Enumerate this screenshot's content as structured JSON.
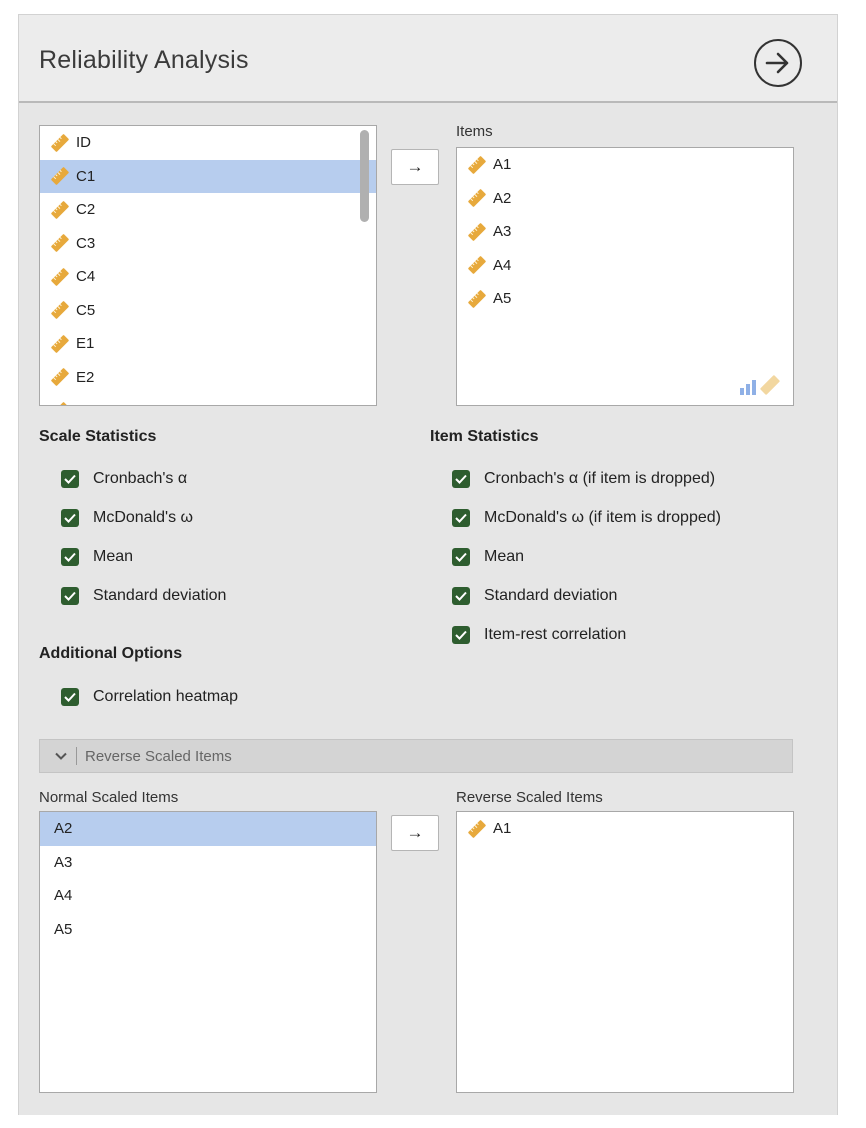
{
  "header": {
    "title": "Reliability Analysis"
  },
  "variables": {
    "items": [
      "ID",
      "C1",
      "C2",
      "C3",
      "C4",
      "C5",
      "E1",
      "E2"
    ],
    "selected_index": 1
  },
  "items_box": {
    "label": "Items",
    "items": [
      "A1",
      "A2",
      "A3",
      "A4",
      "A5"
    ]
  },
  "scale_statistics": {
    "heading": "Scale Statistics",
    "options": [
      "Cronbach's α",
      "McDonald's ω",
      "Mean",
      "Standard deviation"
    ]
  },
  "item_statistics": {
    "heading": "Item Statistics",
    "options": [
      "Cronbach's α (if item is dropped)",
      "McDonald's ω (if item is dropped)",
      "Mean",
      "Standard deviation",
      "Item-rest correlation"
    ]
  },
  "additional_options": {
    "heading": "Additional Options",
    "options": [
      "Correlation heatmap"
    ]
  },
  "reverse_section": {
    "title": "Reverse Scaled Items",
    "normal_label": "Normal Scaled Items",
    "normal_items": [
      "A2",
      "A3",
      "A4",
      "A5"
    ],
    "reverse_label": "Reverse Scaled Items",
    "reverse_items": [
      "A1"
    ]
  },
  "arrow_glyph": "→",
  "colors": {
    "selection": "#b7cdee",
    "checkbox": "#2e5d2f",
    "ruler_icon": "#e7a93c"
  }
}
